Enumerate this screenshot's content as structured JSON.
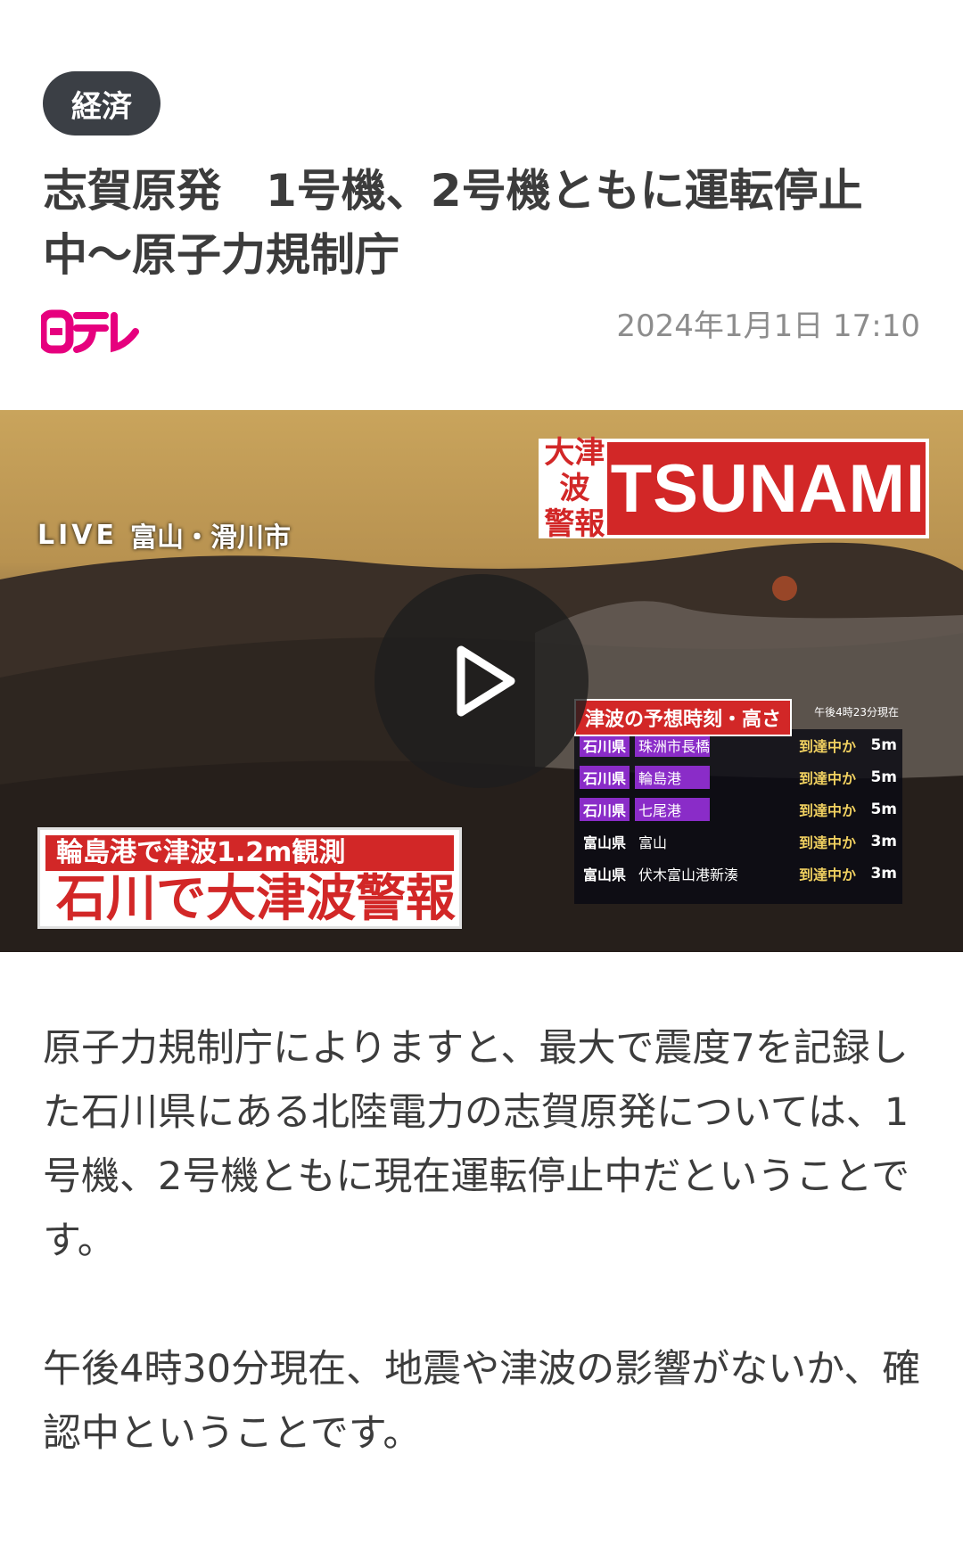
{
  "category": "経済",
  "title": "志賀原発　1号機、2号機ともに運転停止中〜原子力規制庁",
  "source_logo": "日テレ",
  "date": "2024年1月1日 17:10",
  "video": {
    "live_label": "LIVE",
    "location": "富山・滑川市",
    "alert_kanji": "大津波\n警報",
    "alert_en": "TSUNAMI",
    "forecast_title": "津波の予想時刻・高さ",
    "forecast_note": "午後4時23分現在",
    "forecast_rows": [
      {
        "pref": "石川県",
        "place": "珠洲市長橋",
        "status": "到達中か",
        "height": "5m"
      },
      {
        "pref": "石川県",
        "place": "輪島港",
        "status": "到達中か",
        "height": "5m"
      },
      {
        "pref": "石川県",
        "place": "七尾港",
        "status": "到達中か",
        "height": "5m"
      },
      {
        "pref": "富山県",
        "place": "富山",
        "status": "到達中か",
        "height": "3m"
      },
      {
        "pref": "富山県",
        "place": "伏木富山港新湊",
        "status": "到達中か",
        "height": "3m"
      }
    ],
    "caption_top": "輪島港で津波1.2m観測",
    "caption_main": "石川で大津波警報",
    "play_icon": "play-icon"
  },
  "paragraphs": [
    "原子力規制庁によりますと、最大で震度7を記録した石川県にある北陸電力の志賀原発については、1号機、2号機ともに現在運転停止中だということです。",
    "午後4時30分現在、地震や津波の影響がないか、確認中ということです。"
  ],
  "colors": {
    "brand": "#e6007e",
    "alert": "#d22727",
    "tag_bg": "#3b3f45"
  }
}
